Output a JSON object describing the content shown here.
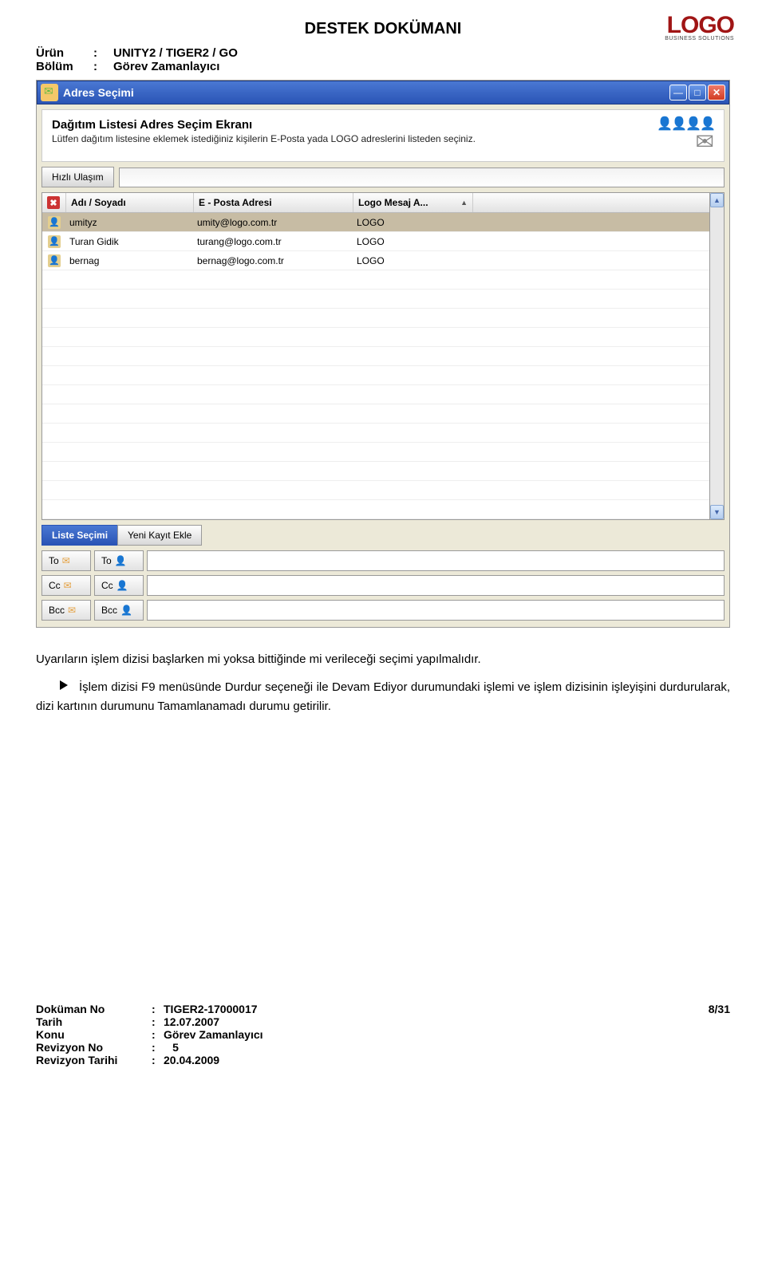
{
  "doc_title": "DESTEK DOKÜMANI",
  "logo": {
    "main": "LOGO",
    "sub": "BUSINESS SOLUTIONS"
  },
  "meta": {
    "product_label": "Ürün",
    "product_value": "UNITY2 / TIGER2 / GO",
    "section_label": "Bölüm",
    "section_value": "Görev Zamanlayıcı"
  },
  "window": {
    "title": "Adres Seçimi",
    "desc_title": "Dağıtım Listesi Adres Seçim Ekranı",
    "desc_sub": "Lütfen dağıtım listesine eklemek istediğiniz kişilerin E-Posta yada LOGO adreslerini listeden seçiniz.",
    "quick_label": "Hızlı Ulaşım",
    "columns": {
      "name": "Adı / Soyadı",
      "email": "E - Posta Adresi",
      "logo_addr": "Logo Mesaj A..."
    },
    "rows": [
      {
        "name": "umityz",
        "email": "umity@logo.com.tr",
        "logo_addr": "LOGO",
        "selected": true
      },
      {
        "name": "Turan Gidik",
        "email": "turang@logo.com.tr",
        "logo_addr": "LOGO",
        "selected": false
      },
      {
        "name": "bernag",
        "email": "bernag@logo.com.tr",
        "logo_addr": "LOGO",
        "selected": false
      }
    ],
    "empty_rows": 13,
    "tabs": {
      "active": "Liste Seçimi",
      "inactive": "Yeni Kayıt Ekle"
    },
    "recipients": [
      {
        "label": "To"
      },
      {
        "label": "Cc"
      },
      {
        "label": "Bcc"
      }
    ]
  },
  "paragraphs": {
    "p1": "Uyarıların işlem dizisi başlarken mi yoksa bittiğinde mi verileceği seçimi yapılmalıdır.",
    "p2": "İşlem dizisi  F9 menüsünde Durdur seçeneği ile Devam Ediyor durumundaki işlemi ve işlem dizisinin işleyişini durdurularak, dizi kartının durumunu Tamamlanamadı durumu getirilir."
  },
  "footer": {
    "doc_no_label": "Doküman No",
    "doc_no_value": "TIGER2-17000017",
    "page": "8/31",
    "date_label": "Tarih",
    "date_value": "12.07.2007",
    "topic_label": "Konu",
    "topic_value": "Görev Zamanlayıcı",
    "rev_no_label": "Revizyon No",
    "rev_no_value": "5",
    "rev_date_label": "Revizyon Tarihi",
    "rev_date_value": "20.04.2009"
  }
}
